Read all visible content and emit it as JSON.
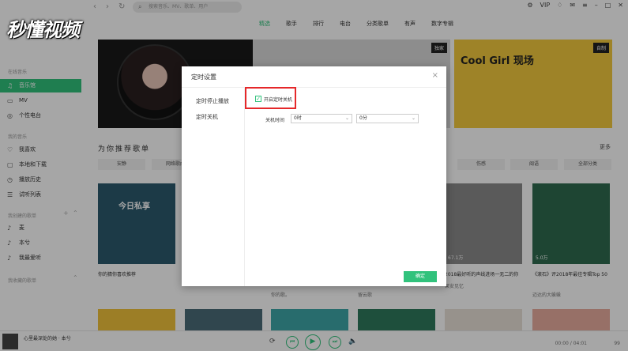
{
  "logo": {
    "text": "秒懂视频"
  },
  "search": {
    "placeholder": "搜索音乐、MV、歌单、用户"
  },
  "topbar": {
    "vip": "VIP"
  },
  "tabs": [
    {
      "label": "精选"
    },
    {
      "label": "歌手"
    },
    {
      "label": "排行"
    },
    {
      "label": "电台"
    },
    {
      "label": "分类歌单"
    },
    {
      "label": "有声"
    },
    {
      "label": "数字专辑"
    }
  ],
  "sidebar": {
    "online_music": "在线音乐",
    "items": [
      {
        "label": "音乐馆"
      },
      {
        "label": "MV"
      },
      {
        "label": "个性电台"
      }
    ],
    "my_music": "我的音乐",
    "my_items": [
      {
        "label": "我喜欢"
      },
      {
        "label": "本地和下载"
      },
      {
        "label": "播放历史"
      },
      {
        "label": "试听列表"
      }
    ],
    "created": "我创建的歌单",
    "created_items": [
      {
        "label": "麦"
      },
      {
        "label": "本兮"
      },
      {
        "label": "我最爱听"
      }
    ],
    "collected": "我收藏的歌单"
  },
  "banners": {
    "tag_exclusive": "独家",
    "tag_custom": "自制",
    "b3_text": "Cool Girl 现场"
  },
  "section": {
    "title": "为你推荐歌单",
    "more": "更多"
  },
  "chips": [
    "安静",
    "网络歌曲",
    "伤感",
    "闽语",
    "全部分类"
  ],
  "cards": {
    "card1_text": "今日私享",
    "card1_caption": "你的猜你喜欢推荐",
    "card4_caption": "你的灵魂歌单",
    "card5_caption": "2018最好听的声线进场一无二的你",
    "card5_sub": "果安见忆",
    "card6_caption": "《滚石》评2018年最佳专辑Top 50",
    "card6_sub": "迈达的大躲躲",
    "card5_plays": "67.1万",
    "card6_plays": "5.0万",
    "card3_sub": "你的歌。",
    "card4_sub": "留云歌"
  },
  "player": {
    "title": "心里最深处的她 · 本兮",
    "time": "00:00 / 04:01",
    "count": "99"
  },
  "dialog": {
    "title": "定时设置",
    "close": "×",
    "nav_stop": "定时停止播放",
    "nav_shutdown": "定时关机",
    "enable_label": "开启定时关机",
    "time_label": "关机时间",
    "hour_value": "0时",
    "minute_value": "0分",
    "ok": "确定"
  }
}
